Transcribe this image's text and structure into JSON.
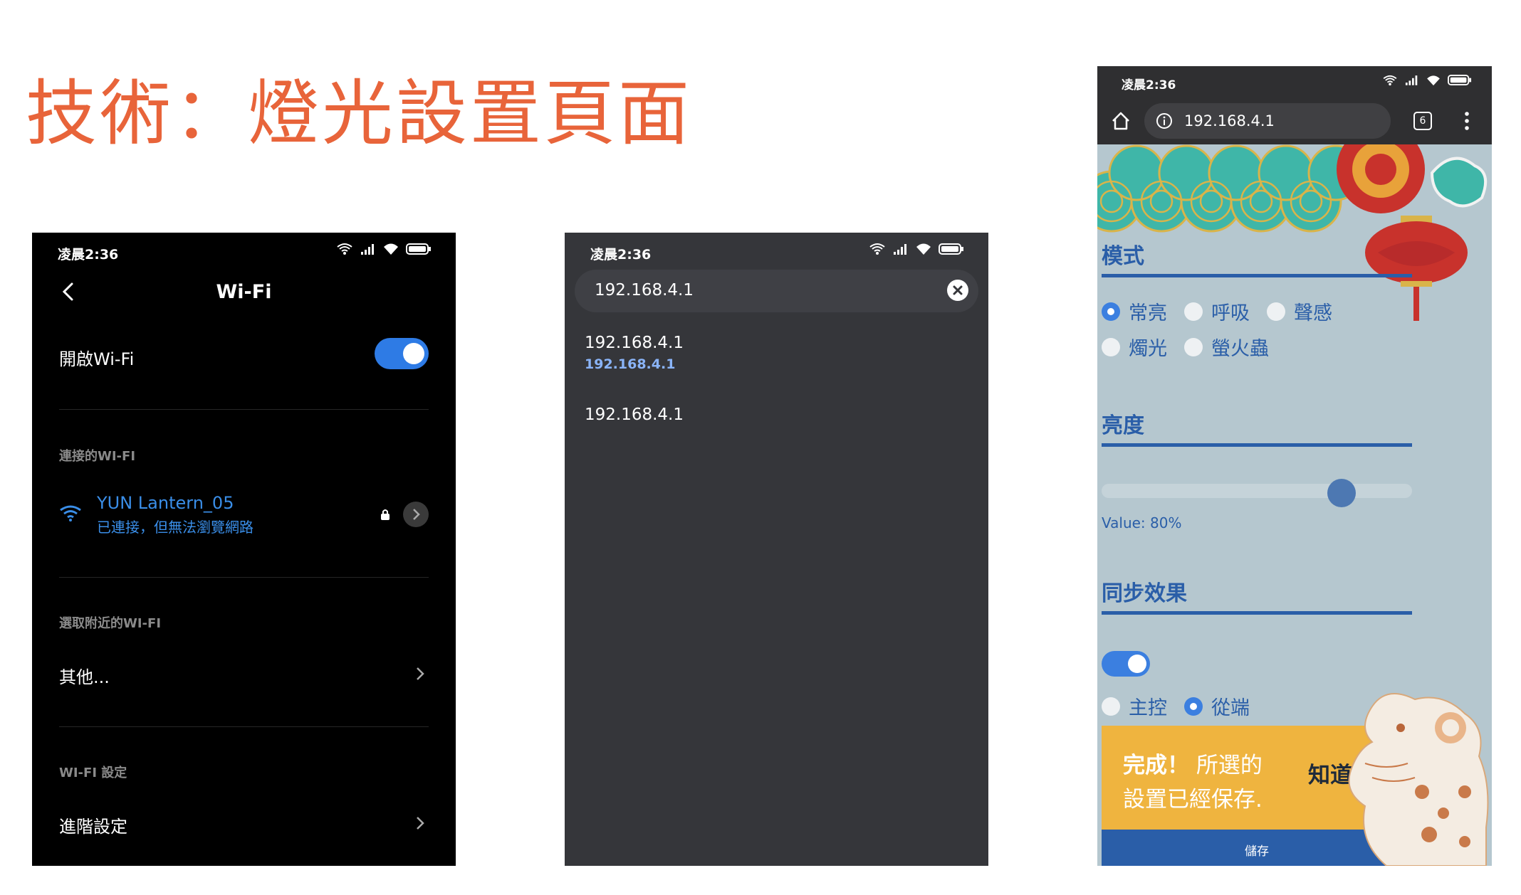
{
  "slide": {
    "title": "技術：燈光設置頁面"
  },
  "phone_wifi": {
    "status_time": "凌晨2:36",
    "title": "Wi-Fi",
    "enable_label": "開啟Wi-Fi",
    "enable_on": true,
    "section_connected": "連接的WI-FI",
    "network_name": "YUN Lantern_05",
    "network_status": "已連接，但無法瀏覽網路",
    "section_nearby": "選取附近的WI-FI",
    "other_label": "其他...",
    "section_settings": "WI-FI 設定",
    "advanced_label": "進階設定"
  },
  "phone_browser": {
    "status_time": "凌晨2:36",
    "search_value": "192.168.4.1",
    "suggestions": [
      {
        "title": "192.168.4.1",
        "url": "192.168.4.1"
      },
      {
        "title": "192.168.4.1"
      }
    ]
  },
  "phone_lantern": {
    "status_time": "凌晨2:36",
    "url": "192.168.4.1",
    "tab_count": "6",
    "mode_heading": "模式",
    "modes": [
      {
        "label": "常亮",
        "selected": true
      },
      {
        "label": "呼吸",
        "selected": false
      },
      {
        "label": "聲感",
        "selected": false
      },
      {
        "label": "燭光",
        "selected": false
      },
      {
        "label": "螢火蟲",
        "selected": false
      }
    ],
    "brightness_heading": "亮度",
    "brightness_value": 80,
    "value_label": "Value: 80%",
    "sync_heading": "同步效果",
    "sync_on": true,
    "roles": [
      {
        "label": "主控",
        "selected": false
      },
      {
        "label": "從端",
        "selected": true
      }
    ],
    "toast_strong": "完成！",
    "toast_rest": " 所選的",
    "toast_line2": "設置已經保存.",
    "toast_button": "知道了",
    "save_label": "儲存",
    "colors": {
      "accent": "#2a5ea8",
      "toast": "#efb43f",
      "background": "#b5c7cf"
    }
  }
}
